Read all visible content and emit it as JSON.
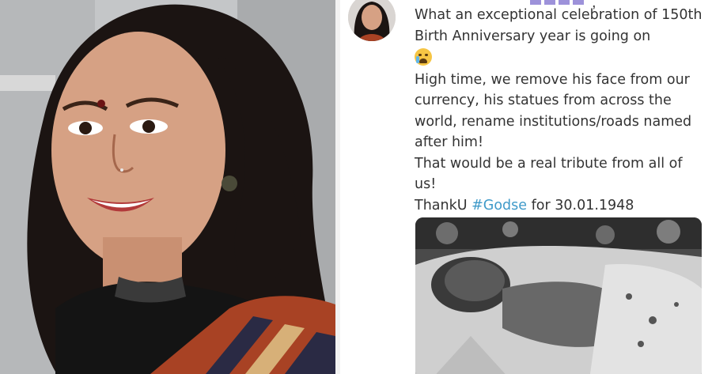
{
  "tweet": {
    "lines": [
      "What an exceptional celebration of 150th Birth Anniversary year is going on",
      "High time, we remove his face from our currency, his statues from across the world, rename institutions/roads named after him!",
      "That would be a real tribute from all of us!"
    ],
    "thanks_prefix": "ThankU ",
    "hashtag": "#Godse",
    "thanks_suffix": " for 30.01.1948",
    "emoji": "crying-face-emoji"
  },
  "colors": {
    "hashtag": "#3f9ac9",
    "text": "#333333",
    "name_redaction": "#8c7fd4"
  }
}
